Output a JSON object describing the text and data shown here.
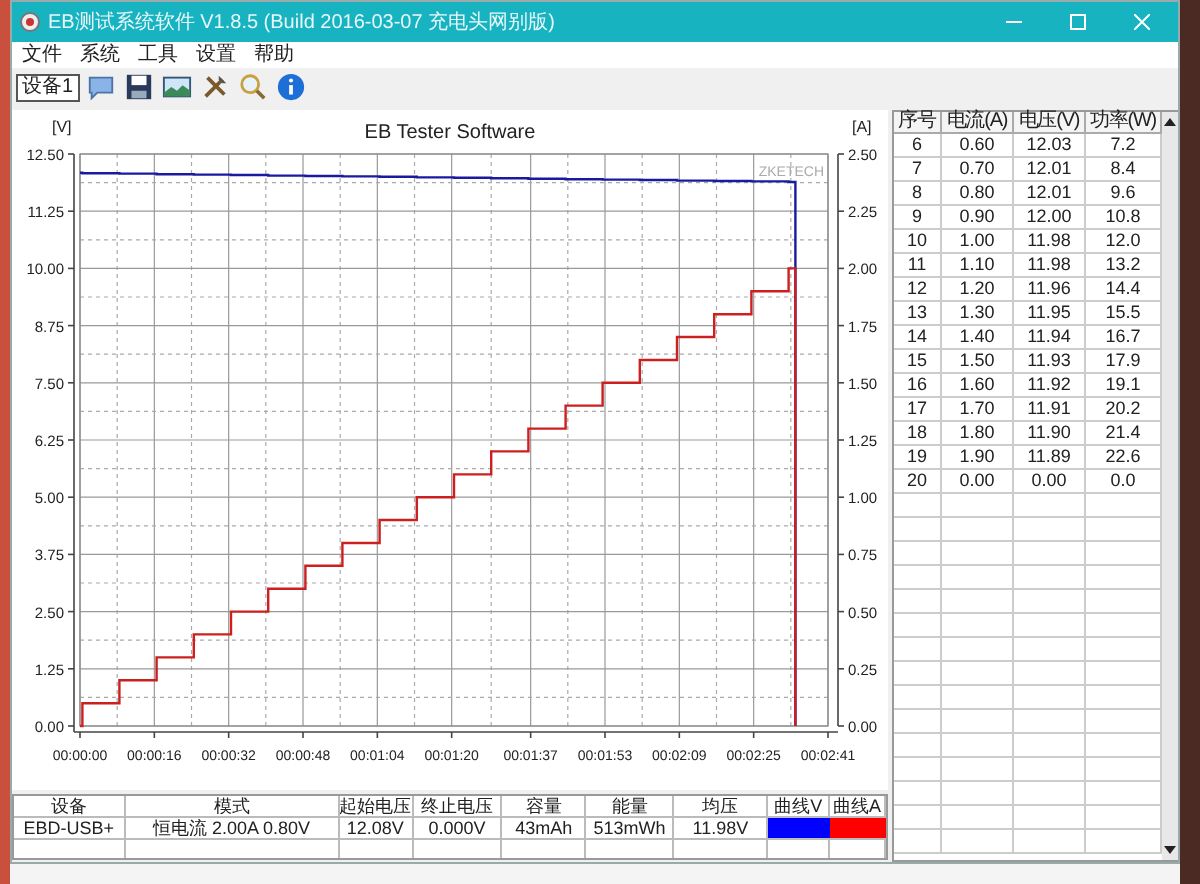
{
  "window": {
    "title": "EB测试系统软件 V1.8.5 (Build 2016-03-07 充电头网别版)"
  },
  "menu": [
    "文件",
    "系统",
    "工具",
    "设置",
    "帮助"
  ],
  "toolbar": {
    "device": "设备1"
  },
  "chart": {
    "logo_text": "ZKETECH",
    "left_unit": "[V]",
    "right_unit": "[A]",
    "chart_data": {
      "type": "line",
      "title": "EB Tester Software",
      "grid": true,
      "x": [
        0,
        0.5,
        0.5,
        8.5,
        8.5,
        16.5,
        16.5,
        24.5,
        24.5,
        32.5,
        32.5,
        40.5,
        40.5,
        48.5,
        48.5,
        56.5,
        56.5,
        64.5,
        64.5,
        72.5,
        72.5,
        80.5,
        80.5,
        88.5,
        88.5,
        96.5,
        96.5,
        104.5,
        104.5,
        112.5,
        112.5,
        120.5,
        120.5,
        128.5,
        128.5,
        136.5,
        136.5,
        144.5,
        144.5,
        152.5,
        152.5,
        154,
        154
      ],
      "series": [
        {
          "color": "#1a1aa0",
          "values": [
            12.09,
            12.09,
            12.08,
            12.08,
            12.07,
            12.07,
            12.06,
            12.06,
            12.05,
            12.05,
            12.04,
            12.04,
            12.03,
            12.03,
            12.02,
            12.02,
            12.01,
            12.01,
            12.0,
            12.0,
            11.99,
            11.99,
            11.98,
            11.98,
            11.97,
            11.97,
            11.96,
            11.96,
            11.95,
            11.95,
            11.94,
            11.94,
            11.93,
            11.93,
            11.92,
            11.92,
            11.91,
            11.91,
            11.9,
            11.9,
            11.89,
            11.89,
            0
          ]
        },
        {
          "axis": "y2",
          "color": "#cc2020",
          "values": [
            0,
            0,
            0.1,
            0.1,
            0.2,
            0.2,
            0.3,
            0.3,
            0.4,
            0.4,
            0.5,
            0.5,
            0.6,
            0.6,
            0.7,
            0.7,
            0.8,
            0.8,
            0.9,
            0.9,
            1.0,
            1.0,
            1.1,
            1.1,
            1.2,
            1.2,
            1.3,
            1.3,
            1.4,
            1.4,
            1.5,
            1.5,
            1.6,
            1.6,
            1.7,
            1.7,
            1.8,
            1.8,
            1.9,
            1.9,
            2.0,
            2.0,
            0
          ]
        }
      ],
      "xlim": [
        0,
        161
      ],
      "ylim": [
        0,
        12.5
      ],
      "y2lim": [
        0,
        2.5
      ],
      "xticks": [
        {
          "value": 0,
          "label": "00:00:00"
        },
        {
          "value": 16,
          "label": "00:00:16"
        },
        {
          "value": 32,
          "label": "00:00:32"
        },
        {
          "value": 48,
          "label": "00:00:48"
        },
        {
          "value": 64,
          "label": "00:01:04"
        },
        {
          "value": 80,
          "label": "00:01:20"
        },
        {
          "value": 97,
          "label": "00:01:37"
        },
        {
          "value": 113,
          "label": "00:01:53"
        },
        {
          "value": 129,
          "label": "00:02:09"
        },
        {
          "value": 145,
          "label": "00:02:25"
        },
        {
          "value": 161,
          "label": "00:02:41"
        }
      ],
      "yticks": [
        {
          "value": 0,
          "label": "0.00"
        },
        {
          "value": 1.25,
          "label": "1.25"
        },
        {
          "value": 2.5,
          "label": "2.50"
        },
        {
          "value": 3.75,
          "label": "3.75"
        },
        {
          "value": 5,
          "label": "5.00"
        },
        {
          "value": 6.25,
          "label": "6.25"
        },
        {
          "value": 7.5,
          "label": "7.50"
        },
        {
          "value": 8.75,
          "label": "8.75"
        },
        {
          "value": 10,
          "label": "10.00"
        },
        {
          "value": 11.25,
          "label": "11.25"
        },
        {
          "value": 12.5,
          "label": "12.50"
        }
      ],
      "y2ticks": [
        {
          "value": 0,
          "label": "0.00"
        },
        {
          "value": 0.25,
          "label": "0.25"
        },
        {
          "value": 0.5,
          "label": "0.50"
        },
        {
          "value": 0.75,
          "label": "0.75"
        },
        {
          "value": 1,
          "label": "1.00"
        },
        {
          "value": 1.25,
          "label": "1.25"
        },
        {
          "value": 1.5,
          "label": "1.50"
        },
        {
          "value": 1.75,
          "label": "1.75"
        },
        {
          "value": 2,
          "label": "2.00"
        },
        {
          "value": 2.25,
          "label": "2.25"
        },
        {
          "value": 2.5,
          "label": "2.50"
        }
      ]
    }
  },
  "summary": {
    "columns": [
      "设备",
      "模式",
      "起始电压",
      "终止电压",
      "容量",
      "能量",
      "均压",
      "曲线V",
      "曲线A"
    ],
    "row": [
      {
        "kind": "text",
        "text": "EBD-USB+"
      },
      {
        "kind": "text",
        "text": "恒电流 2.00A 0.80V"
      },
      {
        "kind": "text",
        "text": "12.08V"
      },
      {
        "kind": "text",
        "text": "0.000V"
      },
      {
        "kind": "text",
        "text": "43mAh"
      },
      {
        "kind": "text",
        "text": "513mWh"
      },
      {
        "kind": "text",
        "text": "11.98V"
      },
      {
        "kind": "swatch",
        "color": "#0000ff"
      },
      {
        "kind": "swatch",
        "color": "#ff0000"
      }
    ]
  },
  "table": {
    "columns": [
      "序号",
      "电流(A)",
      "电压(V)",
      "功率(W)"
    ],
    "rows": [
      [
        "6",
        "0.60",
        "12.03",
        "7.2"
      ],
      [
        "7",
        "0.70",
        "12.01",
        "8.4"
      ],
      [
        "8",
        "0.80",
        "12.01",
        "9.6"
      ],
      [
        "9",
        "0.90",
        "12.00",
        "10.8"
      ],
      [
        "10",
        "1.00",
        "11.98",
        "12.0"
      ],
      [
        "11",
        "1.10",
        "11.98",
        "13.2"
      ],
      [
        "12",
        "1.20",
        "11.96",
        "14.4"
      ],
      [
        "13",
        "1.30",
        "11.95",
        "15.5"
      ],
      [
        "14",
        "1.40",
        "11.94",
        "16.7"
      ],
      [
        "15",
        "1.50",
        "11.93",
        "17.9"
      ],
      [
        "16",
        "1.60",
        "11.92",
        "19.1"
      ],
      [
        "17",
        "1.70",
        "11.91",
        "20.2"
      ],
      [
        "18",
        "1.80",
        "11.90",
        "21.4"
      ],
      [
        "19",
        "1.90",
        "11.89",
        "22.6"
      ],
      [
        "20",
        "0.00",
        "0.00",
        "0.0"
      ]
    ]
  }
}
